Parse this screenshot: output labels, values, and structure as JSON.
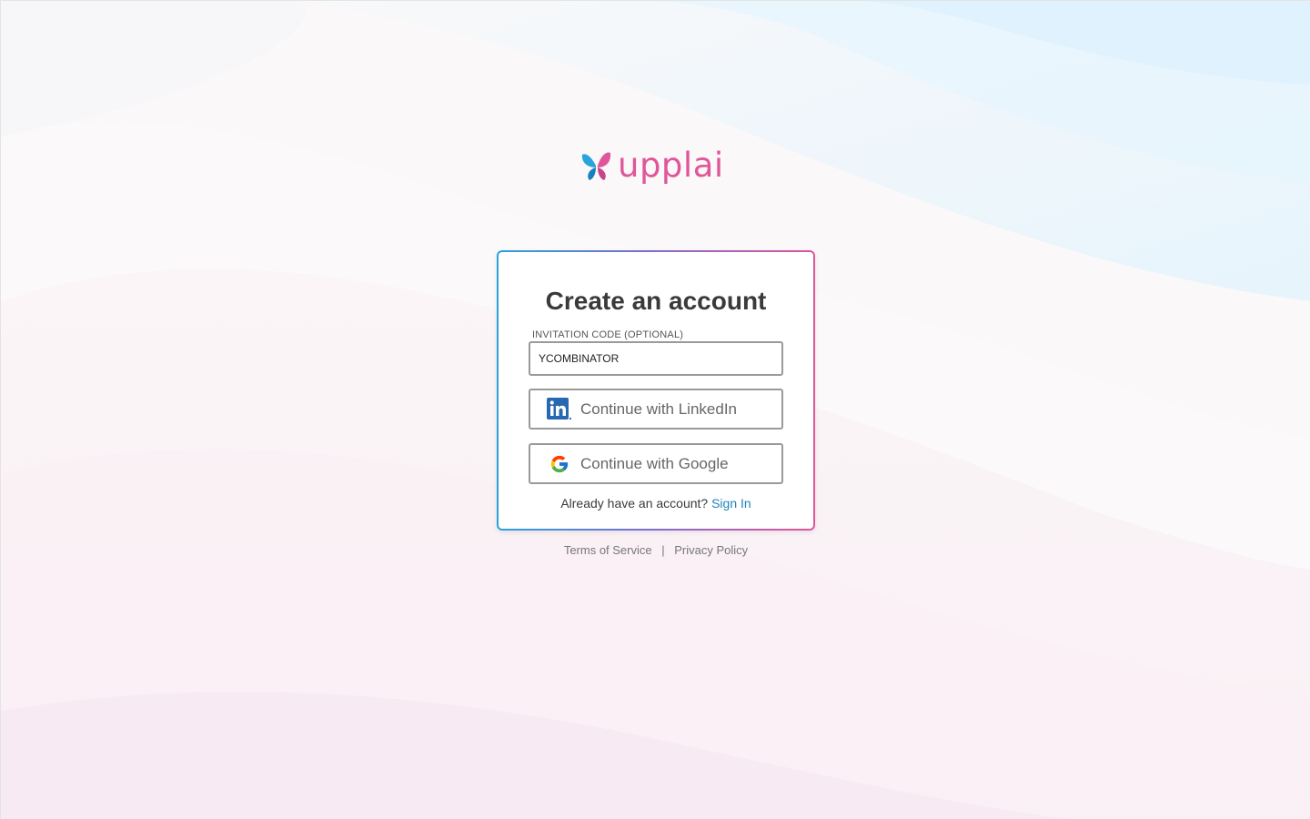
{
  "brand": {
    "name": "upplai",
    "logo_icon": "butterfly-icon",
    "colors": {
      "pink": "#e0569a",
      "blue": "#2aa3dd"
    }
  },
  "card": {
    "title": "Create an account",
    "invite": {
      "label": "INVITATION CODE (OPTIONAL)",
      "value": "YCOMBINATOR"
    },
    "linkedin": {
      "label": "Continue with LinkedIn",
      "icon": "linkedin-icon"
    },
    "google": {
      "label": "Continue with Google",
      "icon": "google-icon"
    },
    "signin": {
      "prompt": "Already have an account?",
      "link": "Sign In"
    }
  },
  "footer": {
    "terms": "Terms of Service",
    "separator": "|",
    "privacy": "Privacy Policy"
  }
}
